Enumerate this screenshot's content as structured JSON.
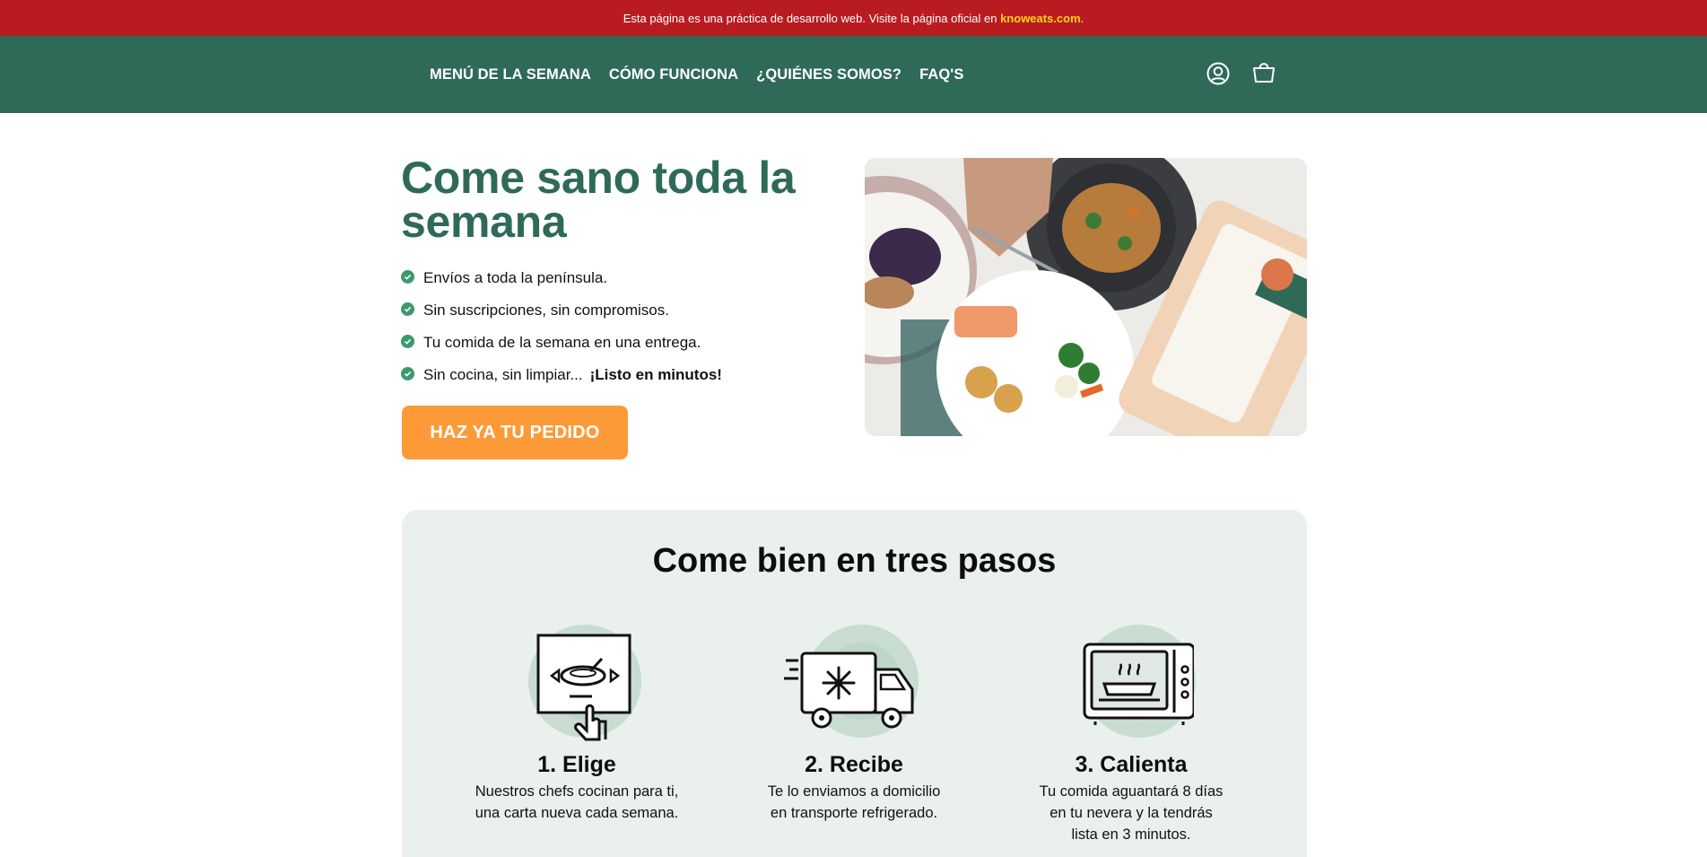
{
  "notice": {
    "text": "Esta página es una práctica de desarrollo web. Visite la página oficial en ",
    "link": "knoweats.com",
    "suffix": "."
  },
  "nav": {
    "links": [
      "MENÚ DE LA SEMANA",
      "CÓMO FUNCIONA",
      "¿QUIÉNES SOMOS?",
      "FAQ'S"
    ],
    "icons": [
      "user-icon",
      "shopping-bag-icon"
    ]
  },
  "hero": {
    "title": "Come sano toda la semana",
    "benefits": [
      "Envíos a toda la península.",
      "Sin suscripciones, sin compromisos.",
      "Tu comida de la semana en una entrega.",
      "Sin cocina, sin limpiar..."
    ],
    "benefit_emphasis": "¡Listo en minutos!",
    "cta": "HAZ YA TU PEDIDO"
  },
  "steps": {
    "title": "Come bien en tres pasos",
    "items": [
      {
        "title": "1. Elige",
        "text": "Nuestros chefs cocinan para ti, una carta nueva cada semana.",
        "icon": "menu-select-icon"
      },
      {
        "title": "2. Recibe",
        "text": "Te lo enviamos a domicilio en transporte refrigerado.",
        "icon": "refrigerated-truck-icon"
      },
      {
        "title": "3. Calienta",
        "text": "Tu comida aguantará 8 días en tu nevera y la tendrás lista en 3 minutos.",
        "icon": "microwave-icon"
      }
    ]
  },
  "colors": {
    "notice_bg": "#b81c21",
    "nav_bg": "#2f6a58",
    "accent_green": "#2f6a58",
    "cta_orange": "#fd9a38",
    "steps_bg": "#eaf0ec",
    "link_yellow": "#ffd21a"
  }
}
